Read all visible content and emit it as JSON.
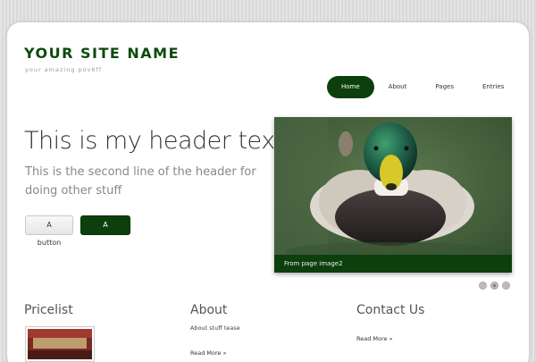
{
  "site": {
    "name": "YOUR SITE NAME",
    "tagline": "your amazing pov6ff"
  },
  "nav": {
    "items": [
      {
        "label": "Home",
        "active": true
      },
      {
        "label": "About",
        "active": false
      },
      {
        "label": "Pages",
        "active": false
      },
      {
        "label": "Entries",
        "active": false
      }
    ]
  },
  "hero": {
    "title": "This is my header text",
    "subtitle": "This is the second line of the header for doing other stuff",
    "button_light": "A button",
    "button_dark": "A button"
  },
  "slider": {
    "caption": "From page image2",
    "dots": 3,
    "active_dot": 2
  },
  "columns": {
    "pricelist": {
      "title": "Pricelist"
    },
    "about": {
      "title": "About",
      "text": "About stuff tease",
      "link": "Read More »"
    },
    "contact": {
      "title": "Contact Us",
      "link": "Read More »"
    }
  },
  "colors": {
    "brand": "#0d3f0d",
    "accent_text": "#0d4a0d"
  }
}
